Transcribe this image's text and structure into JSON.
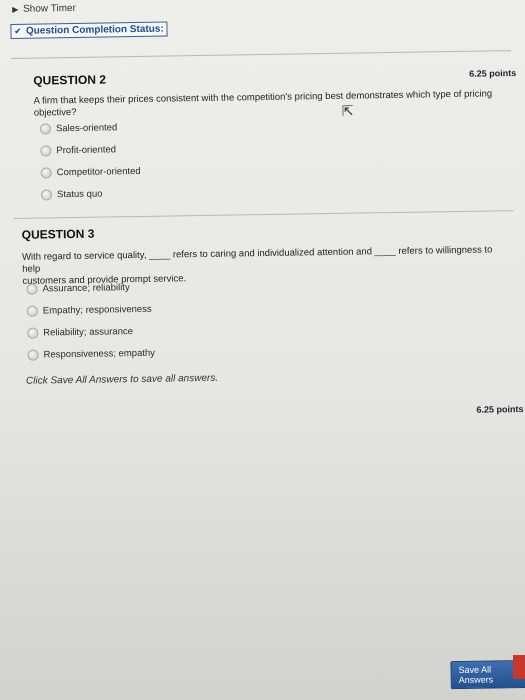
{
  "timer": {
    "label": "Show Timer"
  },
  "completion": {
    "label": "Question Completion Status:"
  },
  "question2": {
    "title": "QUESTION 2",
    "points": "6.25 points",
    "text_line1": "A firm that keeps their prices consistent with the competition's pricing best demonstrates which type of pricing",
    "text_line2": "objective?",
    "options": [
      "Sales-oriented",
      "Profit-oriented",
      "Competitor-oriented",
      "Status quo"
    ]
  },
  "question3": {
    "title": "QUESTION 3",
    "points": "6.25 points",
    "text_line1_a": "With regard to service quality, ",
    "blank1": "____",
    "text_line1_b": " refers to caring and individualized attention and ",
    "blank2": "____",
    "text_line1_c": " refers to willingness to help",
    "text_line2": "customers and provide prompt service.",
    "options": [
      "Assurance; reliability",
      "Empathy; responsiveness",
      "Reliability; assurance",
      "Responsiveness; empathy"
    ]
  },
  "footer": {
    "instruction": "Click Save All Answers to save all answers.",
    "save_all": "Save All Answers"
  }
}
